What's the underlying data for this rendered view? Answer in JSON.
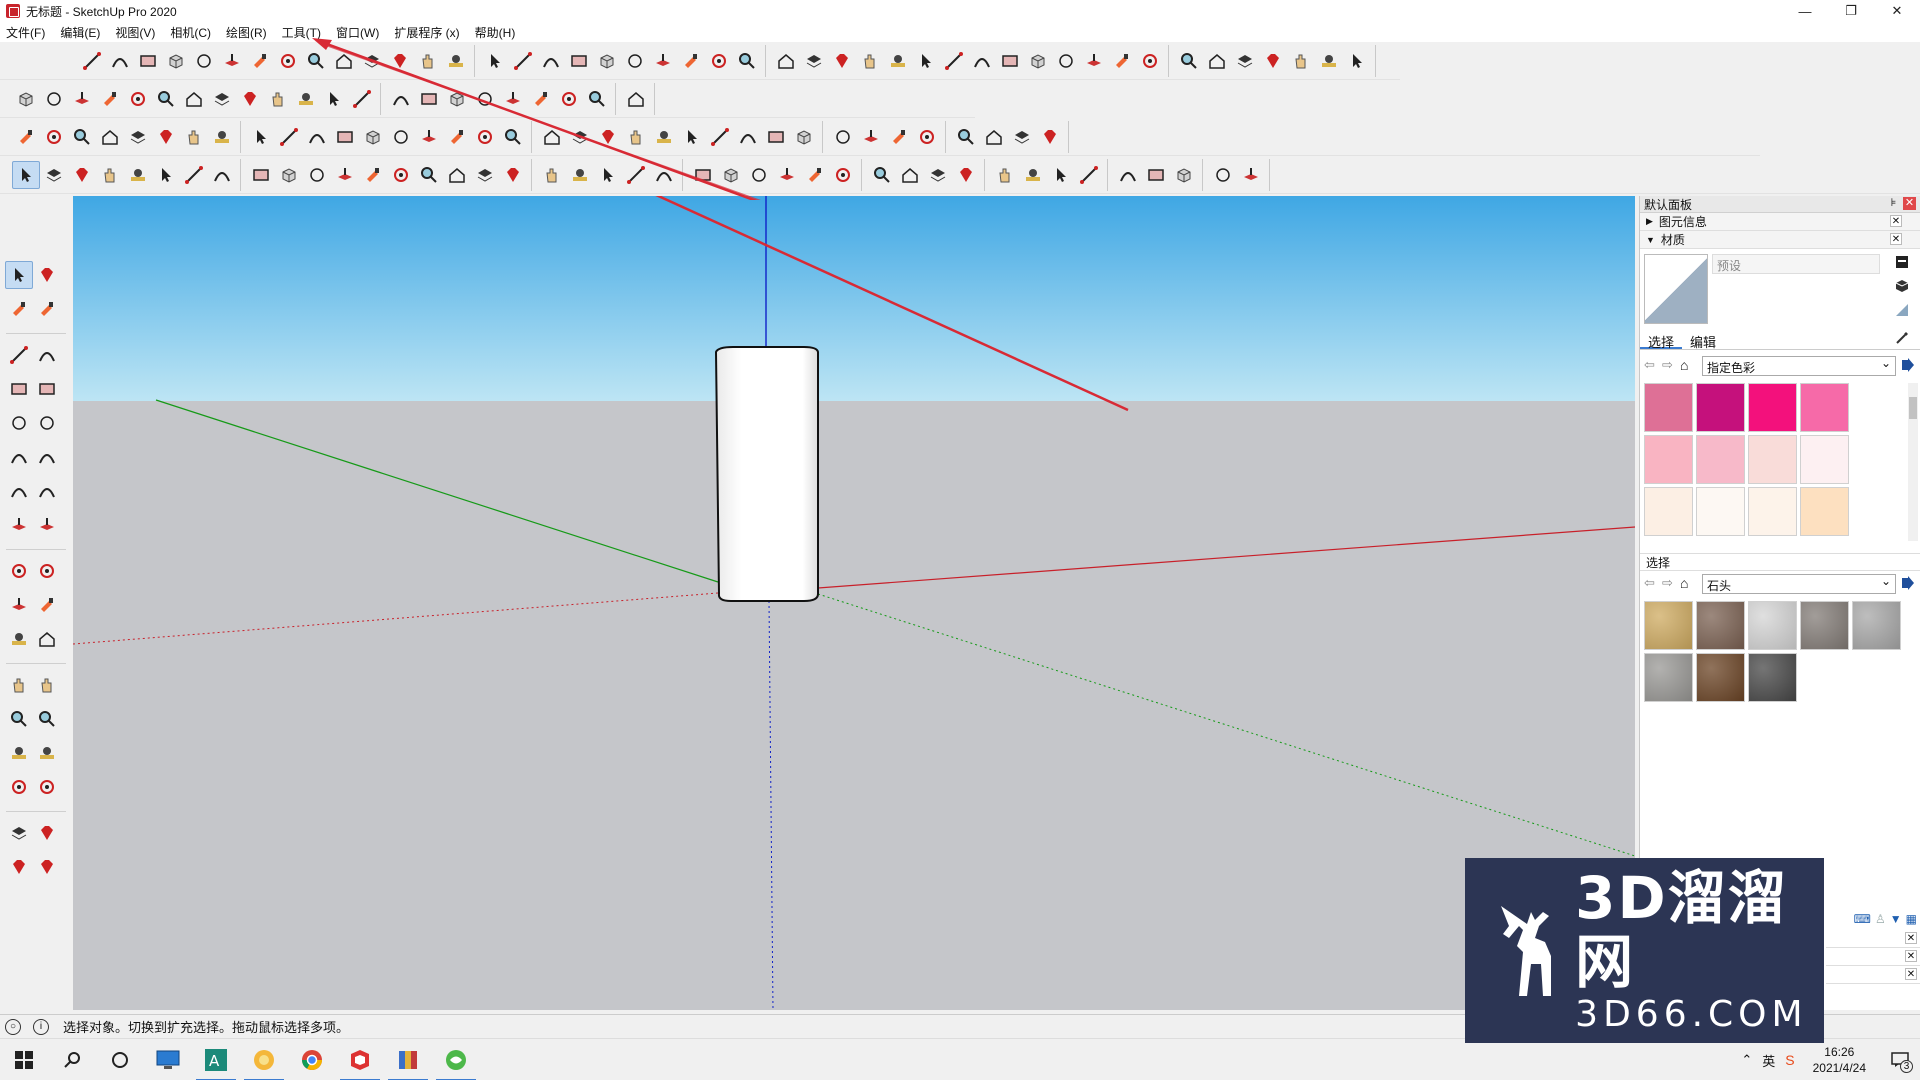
{
  "window": {
    "title": "无标题 - SketchUp Pro 2020",
    "controls": [
      "—",
      "❐",
      "✕"
    ]
  },
  "menu": [
    "文件(F)",
    "编辑(E)",
    "视图(V)",
    "相机(C)",
    "绘图(R)",
    "工具(T)",
    "窗口(W)",
    "扩展程序 (x)",
    "帮助(H)"
  ],
  "right_panel": {
    "tray_title": "默认面板",
    "sections": {
      "entity_info": "图元信息",
      "materials": "材质"
    },
    "name_placeholder": "预设",
    "tabs": {
      "select": "选择",
      "edit": "编辑"
    },
    "library1": "指定色彩",
    "library2_label": "选择",
    "library2": "石头",
    "colors1": [
      "#de7096",
      "#c5117c",
      "#f3117c",
      "#f66aa8",
      "#f9b4c2",
      "#f7b9c9",
      "#f9dcd9",
      "#fdf0f2",
      "#fcefe4",
      "#fdf8f3",
      "#fdf3ea",
      "#fde0c0"
    ],
    "stones": [
      "#cfab61",
      "#7b6152",
      "#d5d5d5",
      "#837c77",
      "#a8a8a8",
      "#999895",
      "#6b4425",
      "#474747"
    ]
  },
  "statusbar": {
    "text": "选择对象。切换到扩充选择。拖动鼠标选择多项。"
  },
  "taskbar": {
    "time": "16:26",
    "date": "2021/4/24",
    "notification_count": "3",
    "ime_label": "英"
  },
  "watermark": {
    "brand": "3D溜溜网",
    "url": "3D66.COM"
  },
  "colors": {
    "sky_top": "#3fa7e4",
    "sky_bottom": "#bde5f4",
    "ground": "#c5c6ca",
    "axis_red": "#c8202a",
    "axis_green": "#169a18",
    "axis_blue": "#1022c8",
    "annotation_red": "#d82a35"
  }
}
